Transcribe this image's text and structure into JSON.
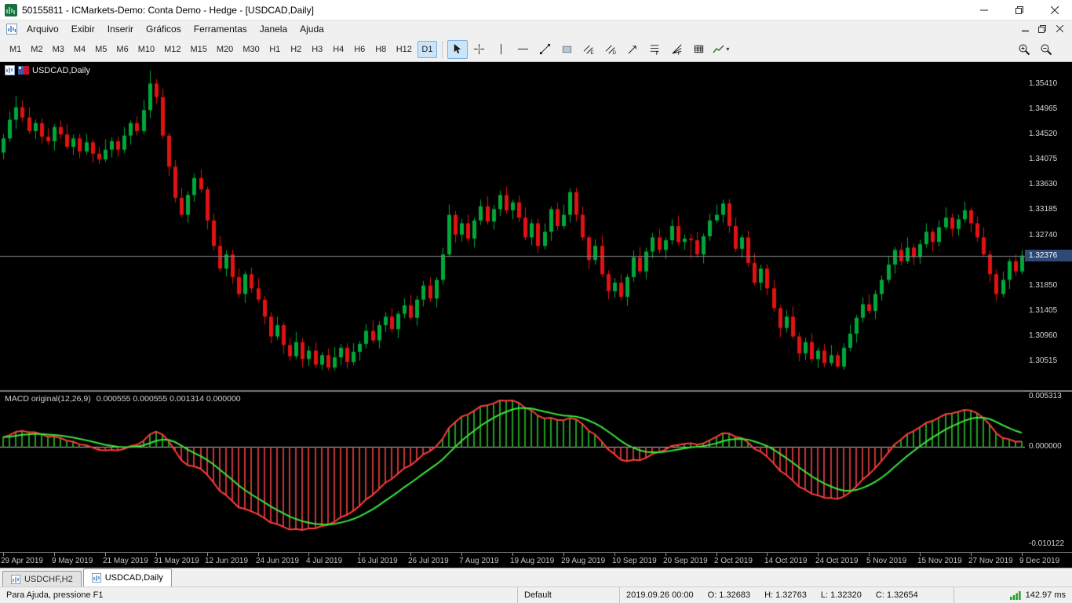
{
  "window": {
    "title": "50155811 - ICMarkets-Demo: Conta Demo - Hedge - [USDCAD,Daily]"
  },
  "menu": {
    "items": [
      "Arquivo",
      "Exibir",
      "Inserir",
      "Gráficos",
      "Ferramentas",
      "Janela",
      "Ajuda"
    ]
  },
  "toolbar": {
    "timeframes": [
      "M1",
      "M2",
      "M3",
      "M4",
      "M5",
      "M6",
      "M10",
      "M12",
      "M15",
      "M20",
      "M30",
      "H1",
      "H2",
      "H3",
      "H4",
      "H6",
      "H8",
      "H12",
      "D1"
    ],
    "active_timeframe": "D1",
    "tools": [
      {
        "name": "cursor-tool",
        "active": true
      },
      {
        "name": "crosshair-tool",
        "active": false
      },
      {
        "name": "vertical-line-tool",
        "active": false
      },
      {
        "name": "horizontal-line-tool",
        "active": false
      },
      {
        "name": "trendline-tool",
        "active": false
      },
      {
        "name": "shapes-tool",
        "active": false
      },
      {
        "name": "equidistant-channel-tool",
        "active": false
      },
      {
        "name": "regression-channel-tool",
        "active": false
      },
      {
        "name": "pitchfork-tool",
        "active": false
      },
      {
        "name": "fibo-retracement-tool",
        "active": false
      },
      {
        "name": "fibo-expansion-tool",
        "active": false
      },
      {
        "name": "objects-list-button",
        "active": false
      },
      {
        "name": "chart-type-dropdown",
        "active": false
      }
    ]
  },
  "chart": {
    "symbol_caption": "USDCAD,Daily",
    "macd_caption": "MACD original(12,26,9)",
    "macd_values": "0.000555 0.000555 0.001314 0.000000"
  },
  "chart_data": {
    "type": "candlestick",
    "symbol": "USDCAD",
    "timeframe": "Daily",
    "price_domain": [
      1.3,
      1.358
    ],
    "bid": 1.32376,
    "price_axis_labels": [
      1.3541,
      1.34965,
      1.3452,
      1.34075,
      1.3363,
      1.33185,
      1.3274,
      1.3185,
      1.31405,
      1.3096,
      1.30515
    ],
    "macd": {
      "params": [
        12,
        26,
        9
      ],
      "axis_labels": [
        "0.005313",
        "0.000000",
        "-0.010122"
      ]
    },
    "label_bar_interval": 8,
    "time_axis_labels": [
      "29 Apr 2019",
      "9 May 2019",
      "21 May 2019",
      "31 May 2019",
      "12 Jun 2019",
      "24 Jun 2019",
      "4 Jul 2019",
      "16 Jul 2019",
      "26 Jul 2019",
      "7 Aug 2019",
      "19 Aug 2019",
      "29 Aug 2019",
      "10 Sep 2019",
      "20 Sep 2019",
      "2 Oct 2019",
      "14 Oct 2019",
      "24 Oct 2019",
      "5 Nov 2019",
      "15 Nov 2019",
      "27 Nov 2019",
      "9 Dec 2019"
    ],
    "candles": [
      [
        1.342,
        1.3453,
        1.3408,
        1.3445
      ],
      [
        1.3445,
        1.3493,
        1.3439,
        1.3478
      ],
      [
        1.3478,
        1.352,
        1.3462,
        1.35
      ],
      [
        1.35,
        1.3512,
        1.3474,
        1.3482
      ],
      [
        1.3482,
        1.35,
        1.3453,
        1.3458
      ],
      [
        1.3458,
        1.3479,
        1.3444,
        1.3472
      ],
      [
        1.3472,
        1.348,
        1.3436,
        1.3448
      ],
      [
        1.3448,
        1.3463,
        1.3434,
        1.344
      ],
      [
        1.344,
        1.347,
        1.3424,
        1.3465
      ],
      [
        1.3465,
        1.3477,
        1.3444,
        1.3452
      ],
      [
        1.3452,
        1.347,
        1.3425,
        1.343
      ],
      [
        1.343,
        1.3452,
        1.3416,
        1.3445
      ],
      [
        1.3445,
        1.3453,
        1.341,
        1.3422
      ],
      [
        1.3422,
        1.3453,
        1.3416,
        1.3438
      ],
      [
        1.3438,
        1.3443,
        1.3402,
        1.3418
      ],
      [
        1.3418,
        1.343,
        1.34,
        1.3408
      ],
      [
        1.3408,
        1.3443,
        1.3403,
        1.3425
      ],
      [
        1.3425,
        1.3447,
        1.3411,
        1.344
      ],
      [
        1.344,
        1.3448,
        1.3413,
        1.3425
      ],
      [
        1.3425,
        1.3465,
        1.3419,
        1.345
      ],
      [
        1.345,
        1.3477,
        1.3434,
        1.3472
      ],
      [
        1.3472,
        1.3484,
        1.345,
        1.3458
      ],
      [
        1.3458,
        1.3513,
        1.3453,
        1.3495
      ],
      [
        1.3495,
        1.3565,
        1.3481,
        1.3542
      ],
      [
        1.3542,
        1.355,
        1.3506,
        1.3518
      ],
      [
        1.3518,
        1.3533,
        1.3444,
        1.345
      ],
      [
        1.345,
        1.3455,
        1.3379,
        1.3395
      ],
      [
        1.3395,
        1.3407,
        1.3332,
        1.334
      ],
      [
        1.334,
        1.3358,
        1.3305,
        1.331
      ],
      [
        1.331,
        1.3352,
        1.3296,
        1.3345
      ],
      [
        1.3345,
        1.3383,
        1.3333,
        1.3375
      ],
      [
        1.3375,
        1.339,
        1.3349,
        1.3355
      ],
      [
        1.3355,
        1.336,
        1.3284,
        1.33
      ],
      [
        1.33,
        1.3312,
        1.3247,
        1.3255
      ],
      [
        1.3255,
        1.3273,
        1.321,
        1.3215
      ],
      [
        1.3215,
        1.3247,
        1.3201,
        1.324
      ],
      [
        1.324,
        1.3248,
        1.3188,
        1.32
      ],
      [
        1.32,
        1.3215,
        1.3164,
        1.317
      ],
      [
        1.317,
        1.321,
        1.3154,
        1.3205
      ],
      [
        1.3205,
        1.3217,
        1.3172,
        1.318
      ],
      [
        1.318,
        1.3198,
        1.3155,
        1.316
      ],
      [
        1.316,
        1.3167,
        1.3116,
        1.313
      ],
      [
        1.313,
        1.3138,
        1.3083,
        1.3095
      ],
      [
        1.3095,
        1.313,
        1.3089,
        1.3115
      ],
      [
        1.3115,
        1.312,
        1.3064,
        1.308
      ],
      [
        1.308,
        1.3092,
        1.3052,
        1.306
      ],
      [
        1.306,
        1.3103,
        1.3055,
        1.3085
      ],
      [
        1.3085,
        1.3092,
        1.3041,
        1.3055
      ],
      [
        1.3055,
        1.3078,
        1.3043,
        1.307
      ],
      [
        1.307,
        1.3085,
        1.3039,
        1.3045
      ],
      [
        1.3045,
        1.3067,
        1.3036,
        1.3062
      ],
      [
        1.3062,
        1.3074,
        1.3035,
        1.304
      ],
      [
        1.304,
        1.3076,
        1.3035,
        1.3058
      ],
      [
        1.3058,
        1.3082,
        1.3044,
        1.3075
      ],
      [
        1.3075,
        1.3083,
        1.3038,
        1.305
      ],
      [
        1.305,
        1.3083,
        1.3044,
        1.3068
      ],
      [
        1.3068,
        1.3087,
        1.3052,
        1.3082
      ],
      [
        1.3082,
        1.3117,
        1.3074,
        1.3105
      ],
      [
        1.3105,
        1.3123,
        1.3083,
        1.3088
      ],
      [
        1.3088,
        1.3122,
        1.3074,
        1.3115
      ],
      [
        1.3115,
        1.3138,
        1.3103,
        1.313
      ],
      [
        1.313,
        1.3145,
        1.3102,
        1.3108
      ],
      [
        1.3108,
        1.314,
        1.3092,
        1.3135
      ],
      [
        1.3135,
        1.3162,
        1.3127,
        1.315
      ],
      [
        1.315,
        1.3168,
        1.3123,
        1.3128
      ],
      [
        1.3128,
        1.3167,
        1.3114,
        1.316
      ],
      [
        1.316,
        1.3193,
        1.3148,
        1.3185
      ],
      [
        1.3185,
        1.32,
        1.3156,
        1.3162
      ],
      [
        1.3162,
        1.32,
        1.3146,
        1.3195
      ],
      [
        1.3195,
        1.3252,
        1.3187,
        1.324
      ],
      [
        1.324,
        1.3328,
        1.3235,
        1.331
      ],
      [
        1.331,
        1.3317,
        1.3261,
        1.3275
      ],
      [
        1.3275,
        1.3303,
        1.3263,
        1.3295
      ],
      [
        1.3295,
        1.331,
        1.3262,
        1.3268
      ],
      [
        1.3268,
        1.3305,
        1.3252,
        1.33
      ],
      [
        1.33,
        1.3337,
        1.3292,
        1.3325
      ],
      [
        1.3325,
        1.3343,
        1.3293,
        1.3298
      ],
      [
        1.3298,
        1.3327,
        1.3284,
        1.332
      ],
      [
        1.332,
        1.3353,
        1.3308,
        1.3345
      ],
      [
        1.3345,
        1.336,
        1.3312,
        1.3318
      ],
      [
        1.3318,
        1.3337,
        1.3302,
        1.3332
      ],
      [
        1.3332,
        1.3344,
        1.3297,
        1.3305
      ],
      [
        1.3305,
        1.3323,
        1.3265,
        1.327
      ],
      [
        1.327,
        1.3302,
        1.3256,
        1.3295
      ],
      [
        1.3295,
        1.3303,
        1.3243,
        1.3255
      ],
      [
        1.3255,
        1.3295,
        1.3249,
        1.328
      ],
      [
        1.328,
        1.3325,
        1.3264,
        1.332
      ],
      [
        1.332,
        1.3332,
        1.3282,
        1.329
      ],
      [
        1.329,
        1.3328,
        1.3285,
        1.331
      ],
      [
        1.331,
        1.3357,
        1.3296,
        1.335
      ],
      [
        1.335,
        1.3358,
        1.3298,
        1.331
      ],
      [
        1.331,
        1.3325,
        1.3264,
        1.327
      ],
      [
        1.327,
        1.3275,
        1.3214,
        1.323
      ],
      [
        1.323,
        1.3267,
        1.3222,
        1.3255
      ],
      [
        1.3255,
        1.3273,
        1.32,
        1.3205
      ],
      [
        1.3205,
        1.3212,
        1.3161,
        1.3175
      ],
      [
        1.3175,
        1.3198,
        1.3163,
        1.319
      ],
      [
        1.319,
        1.3205,
        1.3159,
        1.3165
      ],
      [
        1.3165,
        1.3205,
        1.3149,
        1.32
      ],
      [
        1.32,
        1.3247,
        1.3192,
        1.3235
      ],
      [
        1.3235,
        1.3253,
        1.3205,
        1.321
      ],
      [
        1.321,
        1.3252,
        1.3196,
        1.3245
      ],
      [
        1.3245,
        1.3278,
        1.3233,
        1.327
      ],
      [
        1.327,
        1.3285,
        1.3242,
        1.3248
      ],
      [
        1.3248,
        1.327,
        1.3232,
        1.3265
      ],
      [
        1.3265,
        1.3302,
        1.3257,
        1.329
      ],
      [
        1.329,
        1.3308,
        1.3257,
        1.3262
      ],
      [
        1.3262,
        1.3275,
        1.3248,
        1.3268
      ],
      [
        1.32683,
        1.32763,
        1.3232,
        1.32654
      ],
      [
        1.3265,
        1.328,
        1.3234,
        1.324
      ],
      [
        1.324,
        1.3277,
        1.3224,
        1.3272
      ],
      [
        1.3272,
        1.3312,
        1.3264,
        1.33
      ],
      [
        1.33,
        1.3328,
        1.3295,
        1.331
      ],
      [
        1.331,
        1.3337,
        1.3296,
        1.333
      ],
      [
        1.333,
        1.3338,
        1.3278,
        1.329
      ],
      [
        1.329,
        1.3305,
        1.3244,
        1.325
      ],
      [
        1.325,
        1.3275,
        1.3234,
        1.327
      ],
      [
        1.327,
        1.3282,
        1.3217,
        1.3225
      ],
      [
        1.3225,
        1.3243,
        1.3185,
        1.319
      ],
      [
        1.319,
        1.3222,
        1.3176,
        1.3215
      ],
      [
        1.3215,
        1.3223,
        1.3168,
        1.318
      ],
      [
        1.318,
        1.3195,
        1.3139,
        1.3145
      ],
      [
        1.3145,
        1.315,
        1.3094,
        1.311
      ],
      [
        1.311,
        1.3142,
        1.3102,
        1.313
      ],
      [
        1.313,
        1.3148,
        1.309,
        1.3095
      ],
      [
        1.3095,
        1.3102,
        1.3051,
        1.3065
      ],
      [
        1.3065,
        1.3093,
        1.3053,
        1.3085
      ],
      [
        1.3085,
        1.31,
        1.3049,
        1.3055
      ],
      [
        1.3055,
        1.3075,
        1.3039,
        1.307
      ],
      [
        1.307,
        1.3082,
        1.304,
        1.3048
      ],
      [
        1.3048,
        1.308,
        1.3043,
        1.3062
      ],
      [
        1.3062,
        1.3069,
        1.3038,
        1.3042
      ],
      [
        1.3042,
        1.3083,
        1.3036,
        1.3075
      ],
      [
        1.3075,
        1.3115,
        1.3069,
        1.31
      ],
      [
        1.31,
        1.3133,
        1.3084,
        1.3128
      ],
      [
        1.3128,
        1.3164,
        1.312,
        1.3152
      ],
      [
        1.3152,
        1.317,
        1.3135,
        1.314
      ],
      [
        1.314,
        1.3177,
        1.3126,
        1.317
      ],
      [
        1.317,
        1.3203,
        1.3158,
        1.3195
      ],
      [
        1.3195,
        1.3237,
        1.3189,
        1.3222
      ],
      [
        1.3222,
        1.3253,
        1.3206,
        1.3248
      ],
      [
        1.3248,
        1.326,
        1.322,
        1.3228
      ],
      [
        1.3228,
        1.327,
        1.3223,
        1.3252
      ],
      [
        1.3252,
        1.3259,
        1.3221,
        1.3235
      ],
      [
        1.3235,
        1.3266,
        1.3223,
        1.3258
      ],
      [
        1.3258,
        1.3295,
        1.3252,
        1.328
      ],
      [
        1.328,
        1.3285,
        1.3246,
        1.3262
      ],
      [
        1.3262,
        1.33,
        1.3254,
        1.3288
      ],
      [
        1.3288,
        1.3323,
        1.3283,
        1.3305
      ],
      [
        1.3305,
        1.3312,
        1.3271,
        1.3285
      ],
      [
        1.3285,
        1.331,
        1.3273,
        1.3302
      ],
      [
        1.3302,
        1.3333,
        1.3296,
        1.3318
      ],
      [
        1.3318,
        1.3323,
        1.3279,
        1.3295
      ],
      [
        1.3295,
        1.3307,
        1.3262,
        1.327
      ],
      [
        1.327,
        1.3288,
        1.3235,
        1.324
      ],
      [
        1.324,
        1.3247,
        1.3191,
        1.3205
      ],
      [
        1.3205,
        1.3213,
        1.3158,
        1.317
      ],
      [
        1.317,
        1.321,
        1.3164,
        1.3195
      ],
      [
        1.3195,
        1.3233,
        1.3179,
        1.3228
      ],
      [
        1.3228,
        1.324,
        1.3202,
        1.321
      ],
      [
        1.321,
        1.3248,
        1.3205,
        1.3238
      ]
    ]
  },
  "tabs": [
    {
      "label": "USDCHF,H2",
      "active": false
    },
    {
      "label": "USDCAD,Daily",
      "active": true
    }
  ],
  "status": {
    "help": "Para Ajuda, pressione F1",
    "profile": "Default",
    "bar_time": "2019.09.26 00:00",
    "o": "O: 1.32683",
    "h": "H: 1.32763",
    "l": "L: 1.32320",
    "c": "C: 1.32654",
    "ping": "142.97 ms"
  },
  "colors": {
    "up": "#00a839",
    "down": "#e01212",
    "hist_up": "#1f9d1f",
    "hist_down": "#c33434",
    "macd_line": "#ff3b3b",
    "signal_line": "#3be43b",
    "bid_line": "#7f7f7f",
    "badge_bg": "#2d4a77"
  }
}
